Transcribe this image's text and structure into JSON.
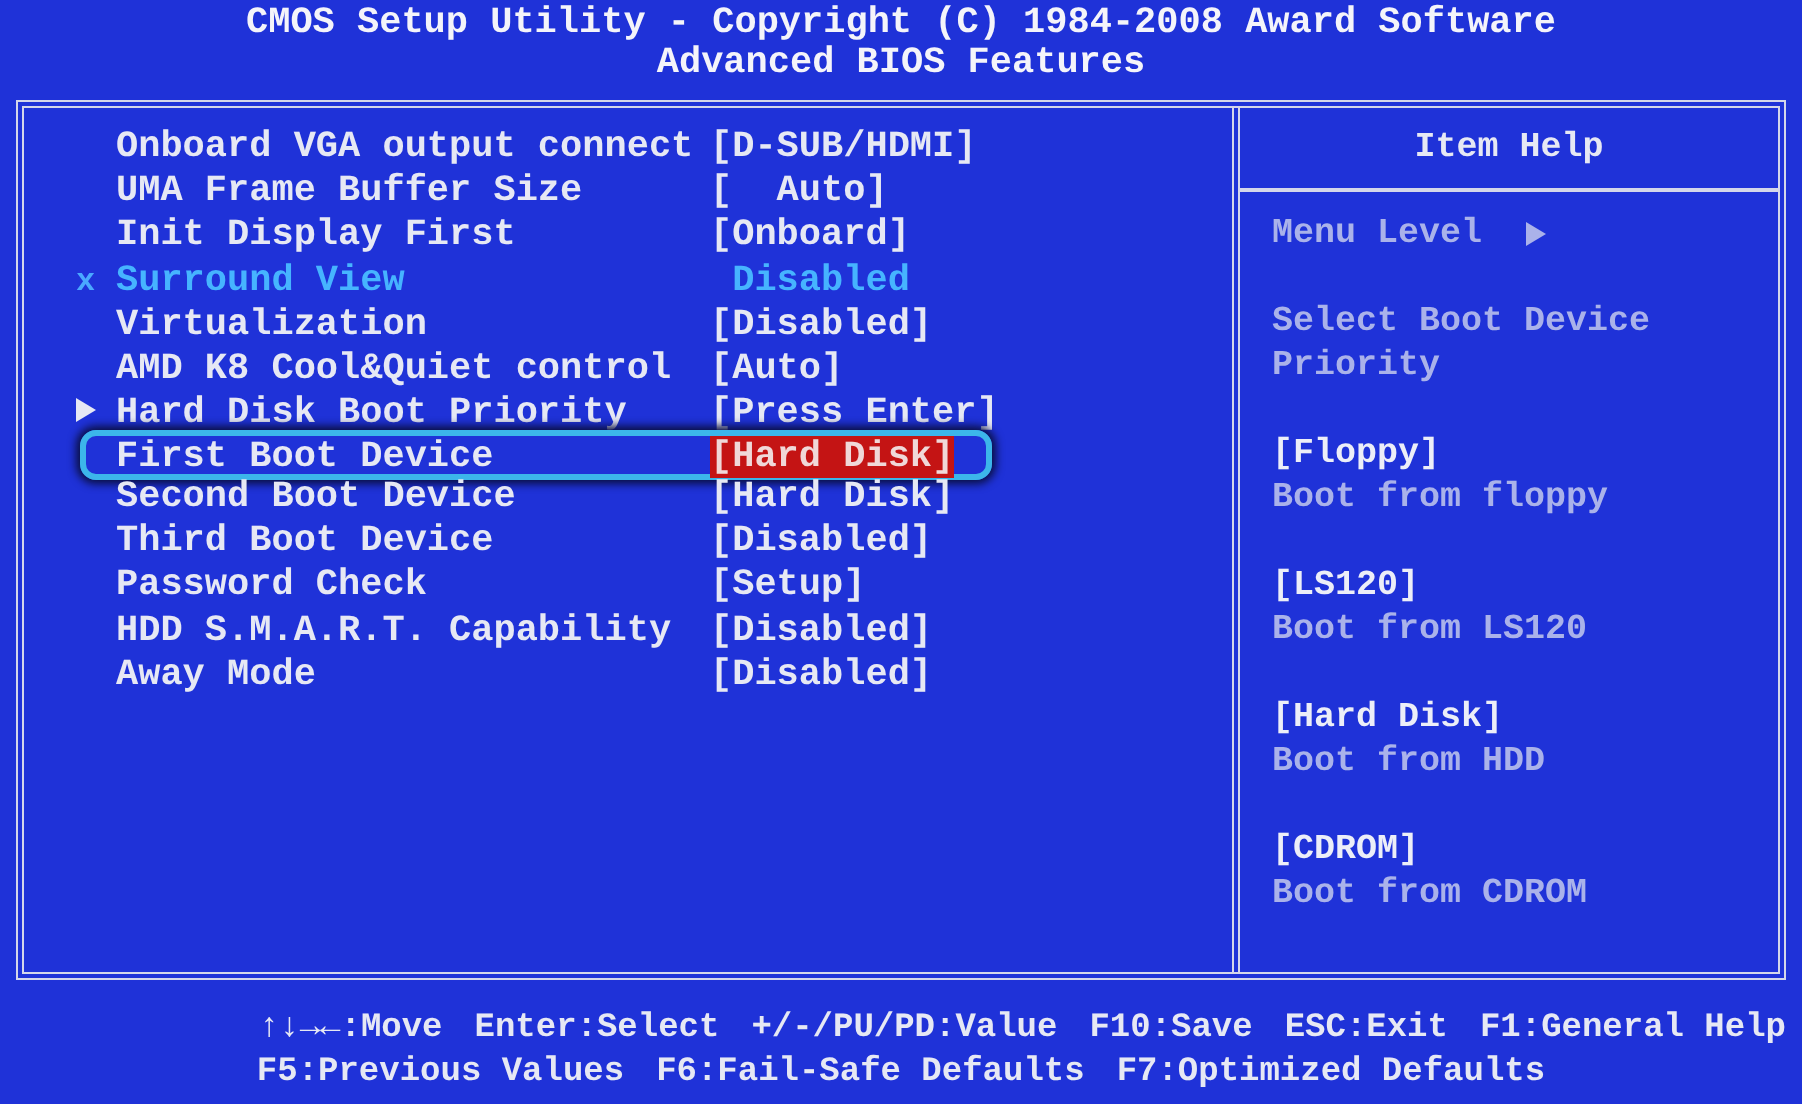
{
  "header": {
    "title": "CMOS Setup Utility - Copyright (C) 1984-2008 Award Software",
    "subtitle": "Advanced BIOS Features"
  },
  "settings": [
    {
      "label": "Onboard VGA output connect",
      "value": "[D-SUB/HDMI]",
      "kind": "option",
      "selected": false
    },
    {
      "label": "UMA Frame Buffer Size",
      "value": "[  Auto]",
      "kind": "option",
      "selected": false
    },
    {
      "label": "Init Display First",
      "value": "[Onboard]",
      "kind": "option",
      "selected": false
    },
    {
      "label": "Surround View",
      "value": " Disabled",
      "kind": "disabled",
      "marker": "x",
      "selected": false
    },
    {
      "label": "Virtualization",
      "value": "[Disabled]",
      "kind": "option",
      "selected": false
    },
    {
      "label": "AMD K8 Cool&Quiet control",
      "value": "[Auto]",
      "kind": "option",
      "selected": false
    },
    {
      "label": "Hard Disk Boot Priority",
      "value": "[Press Enter]",
      "kind": "submenu",
      "selected": false
    },
    {
      "label": "First Boot Device",
      "value": "[Hard Disk]",
      "kind": "option",
      "selected": true
    },
    {
      "label": "Second Boot Device",
      "value": "[Hard Disk]",
      "kind": "option",
      "selected": false
    },
    {
      "label": "Third Boot Device",
      "value": "[Disabled]",
      "kind": "option",
      "selected": false
    },
    {
      "label": "Password Check",
      "value": "[Setup]",
      "kind": "option",
      "selected": false
    },
    {
      "label": "HDD S.M.A.R.T. Capability",
      "value": "[Disabled]",
      "kind": "option",
      "selected": false
    },
    {
      "label": "Away Mode",
      "value": "[Disabled]",
      "kind": "option",
      "selected": false
    }
  ],
  "item_help": {
    "title": "Item Help",
    "menu_level": "Menu Level",
    "description": "Select Boot Device Priority",
    "options": [
      {
        "option": "[Floppy]",
        "description": "Boot from floppy"
      },
      {
        "option": "[LS120]",
        "description": "Boot from LS120"
      },
      {
        "option": "[Hard Disk]",
        "description": "Boot from HDD"
      },
      {
        "option": "[CDROM]",
        "description": "Boot from CDROM"
      }
    ]
  },
  "footer": {
    "lines": [
      [
        "↑↓→←:Move",
        "Enter:Select",
        "+/-/PU/PD:Value",
        "F10:Save",
        "ESC:Exit",
        "F1:General Help"
      ],
      [
        "F5:Previous Values",
        "F6:Fail-Safe Defaults",
        "F7:Optimized Defaults"
      ]
    ]
  }
}
